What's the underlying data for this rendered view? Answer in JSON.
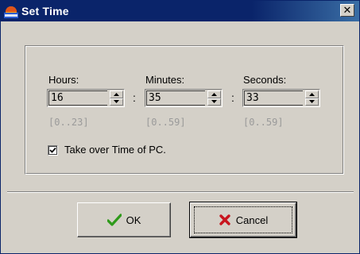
{
  "window": {
    "title": "Set Time",
    "close_glyph": "✕"
  },
  "time": {
    "hours": {
      "label": "Hours:",
      "value": "16",
      "range": "[0..23]"
    },
    "minutes": {
      "label": "Minutes:",
      "value": "35",
      "range": "[0..59]"
    },
    "seconds": {
      "label": "Seconds:",
      "value": "33",
      "range": "[0..59]"
    },
    "separator": ":"
  },
  "checkbox": {
    "label": "Take over Time of PC.",
    "checked": true
  },
  "buttons": {
    "ok": "OK",
    "cancel": "Cancel"
  },
  "icons": {
    "app": "clock-app-icon",
    "ok": "checkmark-icon",
    "cancel": "red-x-icon",
    "spin_up": "arrow-up-icon",
    "spin_down": "arrow-down-icon"
  },
  "colors": {
    "titlebar": "#0a246a",
    "face": "#d4d0c8",
    "ok_check": "#2e9a1a",
    "cancel_x": "#c8141e",
    "range_text": "#9a9a9a"
  }
}
